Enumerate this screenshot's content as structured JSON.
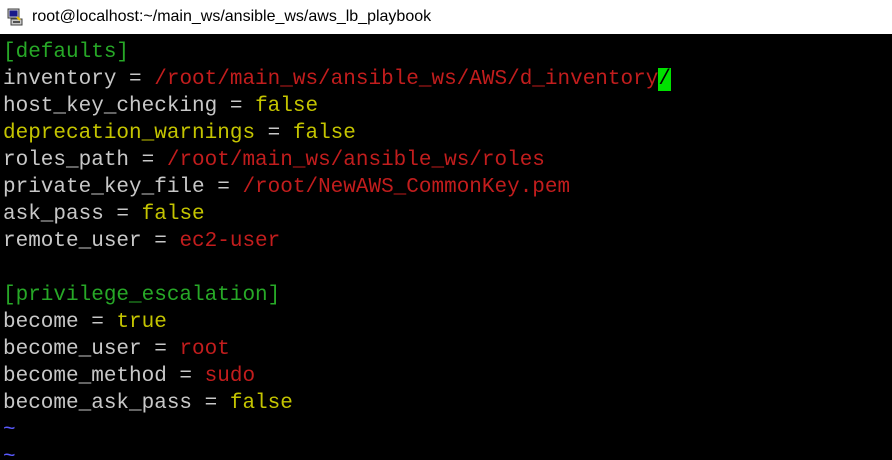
{
  "window": {
    "title": "root@localhost:~/main_ws/ansible_ws/aws_lb_playbook"
  },
  "colors": {
    "section": "#27a827",
    "key_plain": "#c8c8c8",
    "key_yellow": "#c4c400",
    "operator": "#c8c8c8",
    "value_red": "#c21d1d",
    "value_yellow": "#c4c400",
    "tilde": "#5a5aff",
    "cursor_bg": "#00e000"
  },
  "lines": [
    {
      "segments": [
        {
          "text": "[defaults]",
          "color": "#27a827"
        }
      ]
    },
    {
      "segments": [
        {
          "text": "inventory",
          "color": "#c8c8c8"
        },
        {
          "text": " = ",
          "color": "#c8c8c8"
        },
        {
          "text": "/root/main_ws/ansible_ws/AWS/d_inventory",
          "color": "#c21d1d"
        },
        {
          "text": "/",
          "color": "#000000",
          "cursor": true
        }
      ]
    },
    {
      "segments": [
        {
          "text": "host_key_checking",
          "color": "#c8c8c8"
        },
        {
          "text": " = ",
          "color": "#c8c8c8"
        },
        {
          "text": "false",
          "color": "#c4c400"
        }
      ]
    },
    {
      "segments": [
        {
          "text": "deprecation_warnings",
          "color": "#c4c400"
        },
        {
          "text": " = ",
          "color": "#c8c8c8"
        },
        {
          "text": "false",
          "color": "#c4c400"
        }
      ]
    },
    {
      "segments": [
        {
          "text": "roles_path",
          "color": "#c8c8c8"
        },
        {
          "text": " = ",
          "color": "#c8c8c8"
        },
        {
          "text": "/root/main_ws/ansible_ws/roles",
          "color": "#c21d1d"
        }
      ]
    },
    {
      "segments": [
        {
          "text": "private_key_file",
          "color": "#c8c8c8"
        },
        {
          "text": " = ",
          "color": "#c8c8c8"
        },
        {
          "text": "/root/NewAWS_CommonKey.pem",
          "color": "#c21d1d"
        }
      ]
    },
    {
      "segments": [
        {
          "text": "ask_pass",
          "color": "#c8c8c8"
        },
        {
          "text": " = ",
          "color": "#c8c8c8"
        },
        {
          "text": "false",
          "color": "#c4c400"
        }
      ]
    },
    {
      "segments": [
        {
          "text": "remote_user",
          "color": "#c8c8c8"
        },
        {
          "text": " = ",
          "color": "#c8c8c8"
        },
        {
          "text": "ec2-user",
          "color": "#c21d1d"
        }
      ]
    },
    {
      "segments": []
    },
    {
      "segments": [
        {
          "text": "[privilege_escalation]",
          "color": "#27a827"
        }
      ]
    },
    {
      "segments": [
        {
          "text": "become",
          "color": "#c8c8c8"
        },
        {
          "text": " = ",
          "color": "#c8c8c8"
        },
        {
          "text": "true",
          "color": "#c4c400"
        }
      ]
    },
    {
      "segments": [
        {
          "text": "become_user",
          "color": "#c8c8c8"
        },
        {
          "text": " = ",
          "color": "#c8c8c8"
        },
        {
          "text": "root",
          "color": "#c21d1d"
        }
      ]
    },
    {
      "segments": [
        {
          "text": "become_method",
          "color": "#c8c8c8"
        },
        {
          "text": " = ",
          "color": "#c8c8c8"
        },
        {
          "text": "sudo",
          "color": "#c21d1d"
        }
      ]
    },
    {
      "segments": [
        {
          "text": "become_ask_pass",
          "color": "#c8c8c8"
        },
        {
          "text": " = ",
          "color": "#c8c8c8"
        },
        {
          "text": "false",
          "color": "#c4c400"
        }
      ]
    },
    {
      "segments": [
        {
          "text": "~",
          "color": "#5a5aff"
        }
      ]
    },
    {
      "segments": [
        {
          "text": "~",
          "color": "#5a5aff"
        }
      ]
    }
  ]
}
